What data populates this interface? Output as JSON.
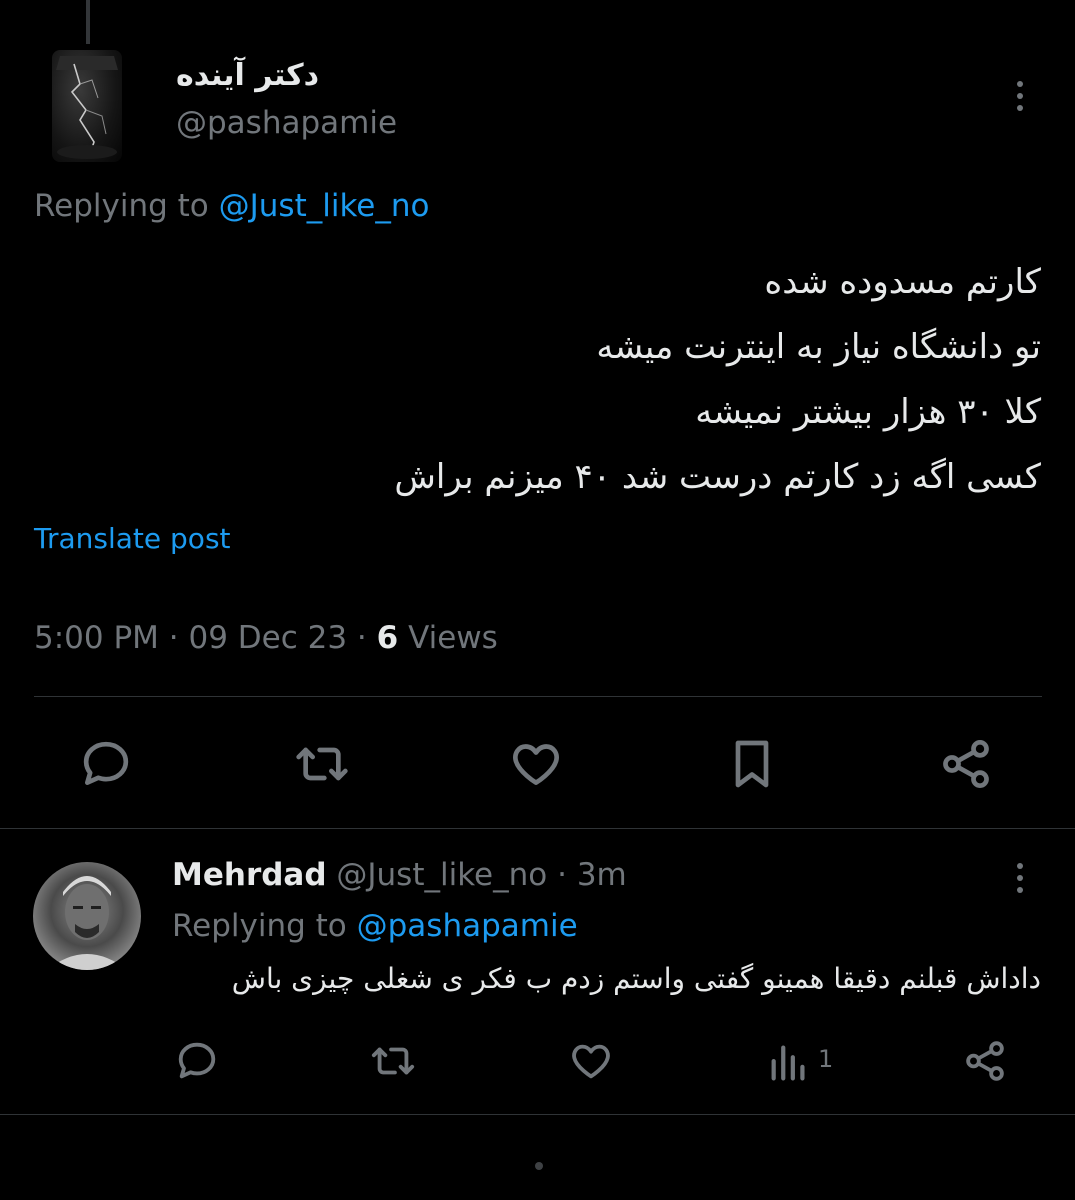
{
  "post": {
    "display_name": "دکتر آینده",
    "handle": "@pashapamie",
    "replying_prefix": "Replying to ",
    "replying_to": "@Just_like_no",
    "lines": [
      "کارتم مسدوده شده",
      "تو دانشگاه نیاز به اینترنت میشه",
      "کلا ۳۰ هزار بیشتر نمیشه",
      "کسی اگه زد کارتم درست شد ۴۰ میزنم براش"
    ],
    "translate_label": "Translate post",
    "time": "5:00 PM",
    "date": "09 Dec 23",
    "separator": " · ",
    "views_count": "6",
    "views_label": " Views",
    "actions": [
      "reply-icon",
      "repost-icon",
      "like-icon",
      "bookmark-icon",
      "share-icon"
    ]
  },
  "reply": {
    "name": "Mehrdad",
    "handle": "@Just_like_no",
    "age": "3m",
    "separator": " · ",
    "replying_prefix": "Replying to ",
    "replying_to": "@pashapamie",
    "text": "داداش قبلنم دقیقا همینو گفتی واستم زدم ب فکر ی شغلی چیزی باش",
    "views": "1",
    "actions": [
      "reply-icon",
      "repost-icon",
      "like-icon",
      "views-icon",
      "share-icon"
    ]
  },
  "colors": {
    "background": "#000000",
    "text": "#e7e9ea",
    "muted": "#71767b",
    "link": "#1d9bf0",
    "divider": "#2f3336"
  }
}
